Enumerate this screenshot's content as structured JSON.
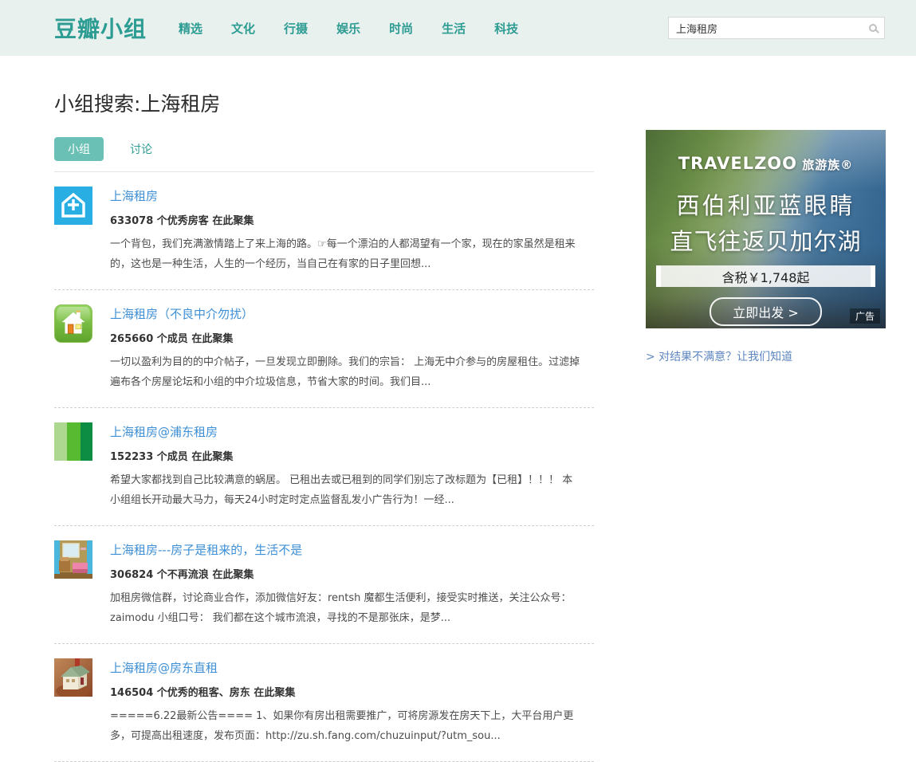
{
  "header": {
    "logo": "豆瓣小组",
    "nav": [
      {
        "label": "精选"
      },
      {
        "label": "文化"
      },
      {
        "label": "行摄"
      },
      {
        "label": "娱乐"
      },
      {
        "label": "时尚"
      },
      {
        "label": "生活"
      },
      {
        "label": "科技"
      }
    ],
    "search": {
      "value": "上海租房"
    }
  },
  "main": {
    "page_title": "小组搜索:上海租房",
    "tabs": [
      {
        "label": "小组",
        "active": true
      },
      {
        "label": "讨论",
        "active": false
      }
    ],
    "results": [
      {
        "title": "上海租房",
        "count": "633078 个优秀房客 在此聚集",
        "description": "一个背包，我们充满激情踏上了来上海的路。☞每一个漂泊的人都渴望有一个家，现在的家虽然是租来的，这也是一种生活，人生的一个经历，当自己在有家的日子里回想...",
        "icon": "blue-house-plus-icon"
      },
      {
        "title": "上海租房（不良中介勿扰）",
        "count": "265660 个成员 在此聚集",
        "description": "一切以盈利为目的的中介帖子，一旦发现立即删除。我们的宗旨： 上海无中介参与的房屋租住。过滤掉遍布各个房屋论坛和小组的中介垃圾信息，节省大家的时间。我们目...",
        "icon": "green-glossy-house-icon"
      },
      {
        "title": "上海租房@浦东租房",
        "count": "152233 个成员 在此聚集",
        "description": "希望大家都找到自己比较满意的蜗居。 已租出去或已租到的同学们别忘了改标题为【已租】！！！ 本小组组长开动最大马力，每天24小时定时定点监督乱发小广告行为！一经...",
        "icon": "green-stripes-icon"
      },
      {
        "title": "上海租房---房子是租来的，生活不是",
        "count": "306824 个不再流浪 在此聚集",
        "description": "加租房微信群，讨论商业合作，添加微信好友：rentsh 魔都生活便利，接受实时推送，关注公众号：zaimodu 小组口号： 我们都在这个城市流浪，寻找的不是那张床，是梦...",
        "icon": "room-photo-icon"
      },
      {
        "title": "上海租房@房东直租",
        "count": "146504 个优秀的租客、房东 在此聚集",
        "description": "=====6.22最新公告==== 1、如果你有房出租需要推广，可将房源发在房天下上，大平台用户更多，可提高出租速度，发布页面：http://zu.sh.fang.com/chuzuinput/?utm_sou...",
        "icon": "hand-house-photo-icon"
      }
    ]
  },
  "sidebar": {
    "ad": {
      "brand": "TRAVELZOO",
      "brand_suffix": " 旅游族®",
      "headline_line1": "西伯利亚蓝眼睛",
      "headline_line2": "直飞往返贝加尔湖",
      "price": "含税￥1,748起",
      "cta": "立即出发 >",
      "ad_label": "广告"
    },
    "feedback_link": "> 对结果不满意？让我们知道"
  },
  "colors": {
    "header_bg": "#E9F1EF",
    "accent_teal": "#2D9C92",
    "tab_active_bg": "#6BC0B6",
    "result_link_blue": "#3D8FD6",
    "feedback_link_blue": "#5E87C1",
    "group_icon_blue": "#29AEE3"
  }
}
